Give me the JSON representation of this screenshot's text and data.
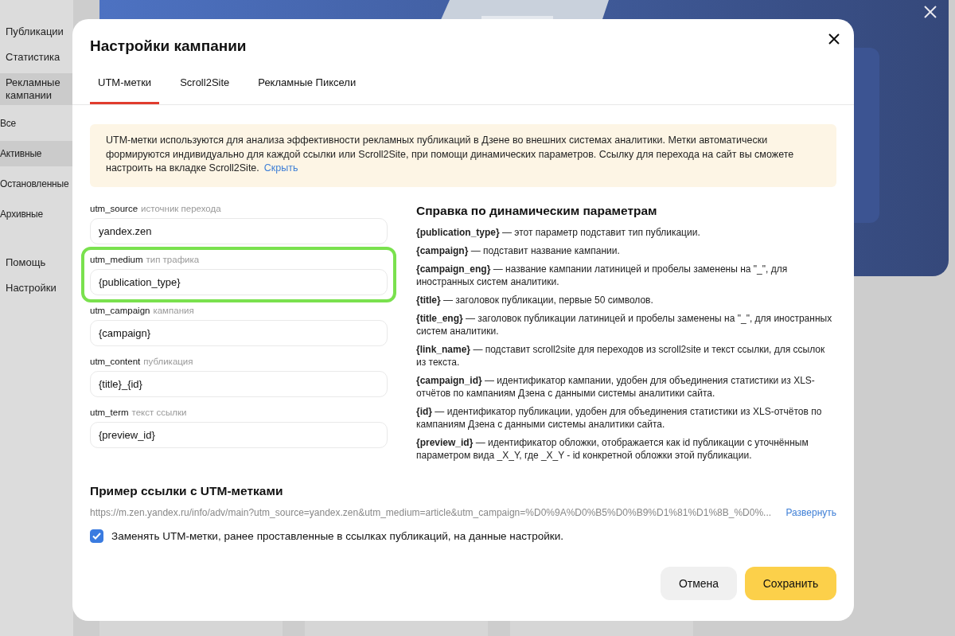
{
  "sidebar": {
    "items": [
      {
        "label": "Публикации",
        "kind": "section",
        "selected": false
      },
      {
        "label": "Статистика",
        "kind": "section",
        "selected": false
      },
      {
        "label": "Рекламные кампании",
        "kind": "section",
        "selected": true
      },
      {
        "label": "Все",
        "kind": "sub",
        "selected": false
      },
      {
        "label": "Активные",
        "kind": "sub",
        "selected": true
      },
      {
        "label": "Остановленные",
        "kind": "sub",
        "selected": false
      },
      {
        "label": "Архивные",
        "kind": "sub",
        "selected": false
      },
      {
        "label": "Помощь",
        "kind": "section",
        "selected": false
      },
      {
        "label": "Настройки",
        "kind": "section",
        "selected": false
      }
    ]
  },
  "dialog": {
    "title": "Настройки кампании",
    "tabs": [
      {
        "label": "UTM-метки",
        "selected": true
      },
      {
        "label": "Scroll2Site",
        "selected": false
      },
      {
        "label": "Рекламные Пиксели",
        "selected": false
      }
    ],
    "notice": {
      "text": "UTM-метки используются для анализа эффективности рекламных публикаций в Дзене во внешних системах аналитики. Метки автоматически формируются индивидуально для каждой ссылки или Scroll2Site, при помощи динамических параметров. Ссылку для перехода на сайт вы сможете настроить на вкладке Scroll2Site.",
      "link": "Скрыть"
    },
    "fields": [
      {
        "name": "utm_source",
        "hint": "источник перехода",
        "value": "yandex.zen",
        "highlighted": false
      },
      {
        "name": "utm_medium",
        "hint": "тип трафика",
        "value": "{publication_type}",
        "highlighted": true
      },
      {
        "name": "utm_campaign",
        "hint": "кампания",
        "value": "{campaign}",
        "highlighted": false
      },
      {
        "name": "utm_content",
        "hint": "публикация",
        "value": "{title}_{id}",
        "highlighted": false
      },
      {
        "name": "utm_term",
        "hint": "текст ссылки",
        "value": "{preview_id}",
        "highlighted": false
      }
    ],
    "help": {
      "title": "Справка по динамическим параметрам",
      "items": [
        "**{publication_type}** — этот параметр подставит тип публикации.",
        "**{campaign}** — подставит название кампании.",
        "**{campaign_eng}** — название кампании латиницей и пробелы заменены на \"_\", для иностранных систем аналитики.",
        "**{title}** — заголовок публикации, первые 50 символов.",
        "**{title_eng}** — заголовок публикации латиницей и пробелы заменены на \"_\", для иностранных систем аналитики.",
        "**{link_name}** — подставит scroll2site для переходов из scroll2site и текст ссылки, для ссылок из текста.",
        "**{campaign_id}** — идентификатор кампании, удобен для объединения статистики из XLS-отчётов по кампаниям Дзена с данными системы аналитики сайта.",
        "**{id}** — идентификатор публикации, удобен для объединения статистики из XLS-отчётов по кампаниям Дзена с данными системы аналитики сайта.",
        "**{preview_id}** — идентификатор обложки, отображается как id публикации с уточнённым параметром вида _X_Y, где _X_Y - id конкретной обложки этой публикации."
      ]
    },
    "example": {
      "title": "Пример ссылки с UTM-метками",
      "url": "https://m.zen.yandex.ru/info/adv/main?utm_source=yandex.zen&utm_medium=article&utm_campaign=%D0%9A%D0%B5%D0%B9%D1%81%D1%8B_%D0%...",
      "expand": "Развернуть"
    },
    "replace_option": {
      "label": "Заменять UTM-метки, ранее проставленные в ссылках публикаций, на данные настройки.",
      "checked": true
    },
    "buttons": [
      {
        "label": "Отмена",
        "kind": "secondary"
      },
      {
        "label": "Сохранить",
        "kind": "primary"
      }
    ]
  }
}
